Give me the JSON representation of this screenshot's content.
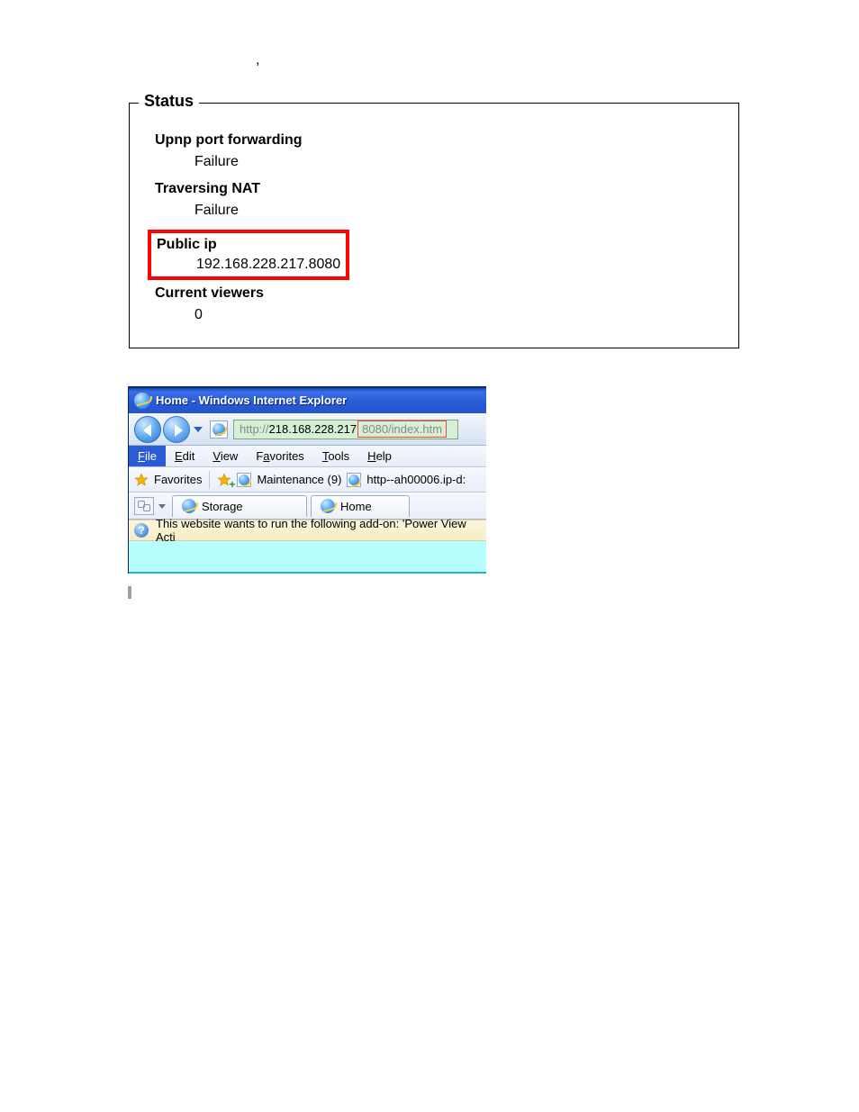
{
  "status": {
    "legend": "Status",
    "upnp_label": "Upnp port forwarding",
    "upnp_value": "Failure",
    "nat_label": "Traversing NAT",
    "nat_value": "Failure",
    "ip_label": "Public ip",
    "ip_value": "192.168.228.217.8080",
    "viewers_label": "Current viewers",
    "viewers_value": "0"
  },
  "ie": {
    "title": "Home - Windows Internet Explorer",
    "url_prefix": "http://",
    "url_host": "218.168.228.217",
    "url_port_path": "8080/index.htm",
    "menu": {
      "file": "File",
      "edit": "Edit",
      "view": "View",
      "favorites": "Favorites",
      "tools": "Tools",
      "help": "Help"
    },
    "fav_label": "Favorites",
    "fav_link1": "Maintenance (9)",
    "fav_link2": "http--ah00006.ip-d:",
    "tab1": "Storage",
    "tab2": "Home",
    "infobar": "This website wants to run the following add-on: 'Power View Acti"
  }
}
